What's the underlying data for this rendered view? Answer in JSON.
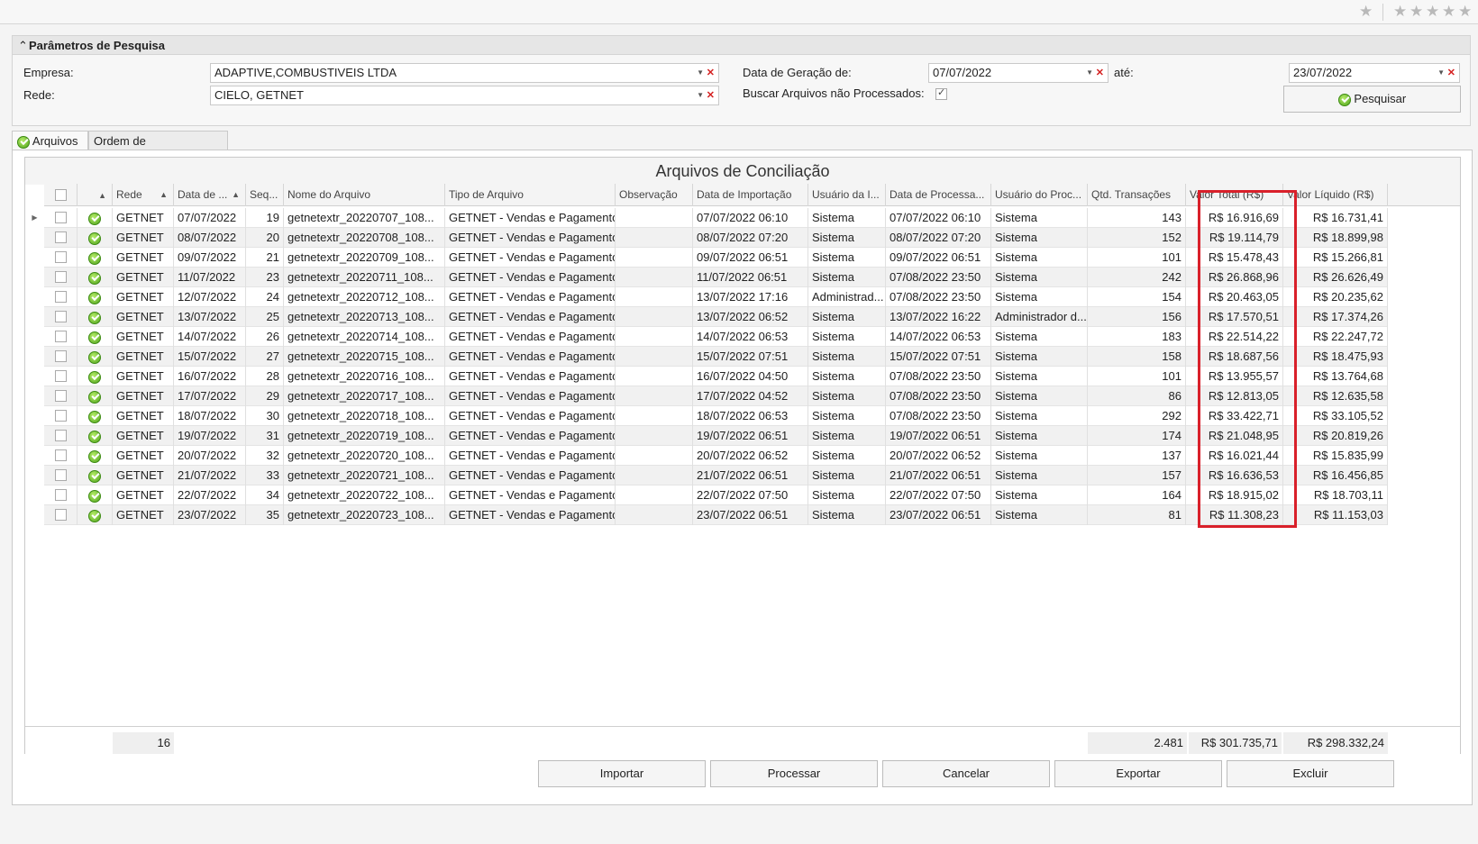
{
  "topbar": {
    "stars": [
      "★",
      "★",
      "★",
      "★",
      "★",
      "★"
    ]
  },
  "params": {
    "title": "Parâmetros de Pesquisa",
    "empresa_label": "Empresa:",
    "empresa_value": "ADAPTIVE,COMBUSTIVEIS LTDA",
    "rede_label": "Rede:",
    "rede_value": "CIELO, GETNET",
    "data_geracao_label": "Data de Geração de:",
    "data_de_value": "07/07/2022",
    "ate_label": "até:",
    "data_ate_value": "23/07/2022",
    "buscar_label": "Buscar Arquivos não Processados:",
    "buscar_checked": true,
    "pesquisar_label": "Pesquisar"
  },
  "tabs": {
    "arquivos": "Arquivos",
    "ordem": "Ordem de Processamento"
  },
  "grid": {
    "title": "Arquivos de Conciliação",
    "headers": [
      "Rede",
      "Data de ...",
      "Seq...",
      "Nome do Arquivo",
      "Tipo de Arquivo",
      "Observação",
      "Data de Importação",
      "Usuário da I...",
      "Data de Processa...",
      "Usuário do Proc...",
      "Qtd. Transações",
      "Valor Total (R$)",
      "Valor Líquido (R$)"
    ],
    "rows": [
      {
        "rede": "GETNET",
        "data": "07/07/2022",
        "seq": "19",
        "nome": "getnetextr_20220707_108...",
        "tipo": "GETNET - Vendas e Pagamentos",
        "obs": "",
        "data_imp": "07/07/2022 06:10",
        "usr_imp": "Sistema",
        "data_proc": "07/07/2022 06:10",
        "usr_proc": "Sistema",
        "qtd": "143",
        "total": "R$ 16.916,69",
        "liquido": "R$ 16.731,41"
      },
      {
        "rede": "GETNET",
        "data": "08/07/2022",
        "seq": "20",
        "nome": "getnetextr_20220708_108...",
        "tipo": "GETNET - Vendas e Pagamentos",
        "obs": "",
        "data_imp": "08/07/2022 07:20",
        "usr_imp": "Sistema",
        "data_proc": "08/07/2022 07:20",
        "usr_proc": "Sistema",
        "qtd": "152",
        "total": "R$ 19.114,79",
        "liquido": "R$ 18.899,98"
      },
      {
        "rede": "GETNET",
        "data": "09/07/2022",
        "seq": "21",
        "nome": "getnetextr_20220709_108...",
        "tipo": "GETNET - Vendas e Pagamentos",
        "obs": "",
        "data_imp": "09/07/2022 06:51",
        "usr_imp": "Sistema",
        "data_proc": "09/07/2022 06:51",
        "usr_proc": "Sistema",
        "qtd": "101",
        "total": "R$ 15.478,43",
        "liquido": "R$ 15.266,81"
      },
      {
        "rede": "GETNET",
        "data": "11/07/2022",
        "seq": "23",
        "nome": "getnetextr_20220711_108...",
        "tipo": "GETNET - Vendas e Pagamentos",
        "obs": "",
        "data_imp": "11/07/2022 06:51",
        "usr_imp": "Sistema",
        "data_proc": "07/08/2022 23:50",
        "usr_proc": "Sistema",
        "qtd": "242",
        "total": "R$ 26.868,96",
        "liquido": "R$ 26.626,49"
      },
      {
        "rede": "GETNET",
        "data": "12/07/2022",
        "seq": "24",
        "nome": "getnetextr_20220712_108...",
        "tipo": "GETNET - Vendas e Pagamentos",
        "obs": "",
        "data_imp": "13/07/2022 17:16",
        "usr_imp": "Administrad...",
        "data_proc": "07/08/2022 23:50",
        "usr_proc": "Sistema",
        "qtd": "154",
        "total": "R$ 20.463,05",
        "liquido": "R$ 20.235,62"
      },
      {
        "rede": "GETNET",
        "data": "13/07/2022",
        "seq": "25",
        "nome": "getnetextr_20220713_108...",
        "tipo": "GETNET - Vendas e Pagamentos",
        "obs": "",
        "data_imp": "13/07/2022 06:52",
        "usr_imp": "Sistema",
        "data_proc": "13/07/2022 16:22",
        "usr_proc": "Administrador d...",
        "qtd": "156",
        "total": "R$ 17.570,51",
        "liquido": "R$ 17.374,26"
      },
      {
        "rede": "GETNET",
        "data": "14/07/2022",
        "seq": "26",
        "nome": "getnetextr_20220714_108...",
        "tipo": "GETNET - Vendas e Pagamentos",
        "obs": "",
        "data_imp": "14/07/2022 06:53",
        "usr_imp": "Sistema",
        "data_proc": "14/07/2022 06:53",
        "usr_proc": "Sistema",
        "qtd": "183",
        "total": "R$ 22.514,22",
        "liquido": "R$ 22.247,72"
      },
      {
        "rede": "GETNET",
        "data": "15/07/2022",
        "seq": "27",
        "nome": "getnetextr_20220715_108...",
        "tipo": "GETNET - Vendas e Pagamentos",
        "obs": "",
        "data_imp": "15/07/2022 07:51",
        "usr_imp": "Sistema",
        "data_proc": "15/07/2022 07:51",
        "usr_proc": "Sistema",
        "qtd": "158",
        "total": "R$ 18.687,56",
        "liquido": "R$ 18.475,93"
      },
      {
        "rede": "GETNET",
        "data": "16/07/2022",
        "seq": "28",
        "nome": "getnetextr_20220716_108...",
        "tipo": "GETNET - Vendas e Pagamentos",
        "obs": "",
        "data_imp": "16/07/2022 04:50",
        "usr_imp": "Sistema",
        "data_proc": "07/08/2022 23:50",
        "usr_proc": "Sistema",
        "qtd": "101",
        "total": "R$ 13.955,57",
        "liquido": "R$ 13.764,68"
      },
      {
        "rede": "GETNET",
        "data": "17/07/2022",
        "seq": "29",
        "nome": "getnetextr_20220717_108...",
        "tipo": "GETNET - Vendas e Pagamentos",
        "obs": "",
        "data_imp": "17/07/2022 04:52",
        "usr_imp": "Sistema",
        "data_proc": "07/08/2022 23:50",
        "usr_proc": "Sistema",
        "qtd": "86",
        "total": "R$ 12.813,05",
        "liquido": "R$ 12.635,58"
      },
      {
        "rede": "GETNET",
        "data": "18/07/2022",
        "seq": "30",
        "nome": "getnetextr_20220718_108...",
        "tipo": "GETNET - Vendas e Pagamentos",
        "obs": "",
        "data_imp": "18/07/2022 06:53",
        "usr_imp": "Sistema",
        "data_proc": "07/08/2022 23:50",
        "usr_proc": "Sistema",
        "qtd": "292",
        "total": "R$ 33.422,71",
        "liquido": "R$ 33.105,52"
      },
      {
        "rede": "GETNET",
        "data": "19/07/2022",
        "seq": "31",
        "nome": "getnetextr_20220719_108...",
        "tipo": "GETNET - Vendas e Pagamentos",
        "obs": "",
        "data_imp": "19/07/2022 06:51",
        "usr_imp": "Sistema",
        "data_proc": "19/07/2022 06:51",
        "usr_proc": "Sistema",
        "qtd": "174",
        "total": "R$ 21.048,95",
        "liquido": "R$ 20.819,26"
      },
      {
        "rede": "GETNET",
        "data": "20/07/2022",
        "seq": "32",
        "nome": "getnetextr_20220720_108...",
        "tipo": "GETNET - Vendas e Pagamentos",
        "obs": "",
        "data_imp": "20/07/2022 06:52",
        "usr_imp": "Sistema",
        "data_proc": "20/07/2022 06:52",
        "usr_proc": "Sistema",
        "qtd": "137",
        "total": "R$ 16.021,44",
        "liquido": "R$ 15.835,99"
      },
      {
        "rede": "GETNET",
        "data": "21/07/2022",
        "seq": "33",
        "nome": "getnetextr_20220721_108...",
        "tipo": "GETNET - Vendas e Pagamentos",
        "obs": "",
        "data_imp": "21/07/2022 06:51",
        "usr_imp": "Sistema",
        "data_proc": "21/07/2022 06:51",
        "usr_proc": "Sistema",
        "qtd": "157",
        "total": "R$ 16.636,53",
        "liquido": "R$ 16.456,85"
      },
      {
        "rede": "GETNET",
        "data": "22/07/2022",
        "seq": "34",
        "nome": "getnetextr_20220722_108...",
        "tipo": "GETNET - Vendas e Pagamentos",
        "obs": "",
        "data_imp": "22/07/2022 07:50",
        "usr_imp": "Sistema",
        "data_proc": "22/07/2022 07:50",
        "usr_proc": "Sistema",
        "qtd": "164",
        "total": "R$ 18.915,02",
        "liquido": "R$ 18.703,11"
      },
      {
        "rede": "GETNET",
        "data": "23/07/2022",
        "seq": "35",
        "nome": "getnetextr_20220723_108...",
        "tipo": "GETNET - Vendas e Pagamentos",
        "obs": "",
        "data_imp": "23/07/2022 06:51",
        "usr_imp": "Sistema",
        "data_proc": "23/07/2022 06:51",
        "usr_proc": "Sistema",
        "qtd": "81",
        "total": "R$ 11.308,23",
        "liquido": "R$ 11.153,03"
      }
    ],
    "footer": {
      "count": "16",
      "qtd_total": "2.481",
      "valor_total": "R$ 301.735,71",
      "valor_liquido": "R$ 298.332,24"
    }
  },
  "actions": {
    "importar": "Importar",
    "processar": "Processar",
    "cancelar": "Cancelar",
    "exportar": "Exportar",
    "excluir": "Excluir"
  },
  "colors": {
    "highlight": "#d9202a",
    "status_ok": "#4fa41a"
  }
}
